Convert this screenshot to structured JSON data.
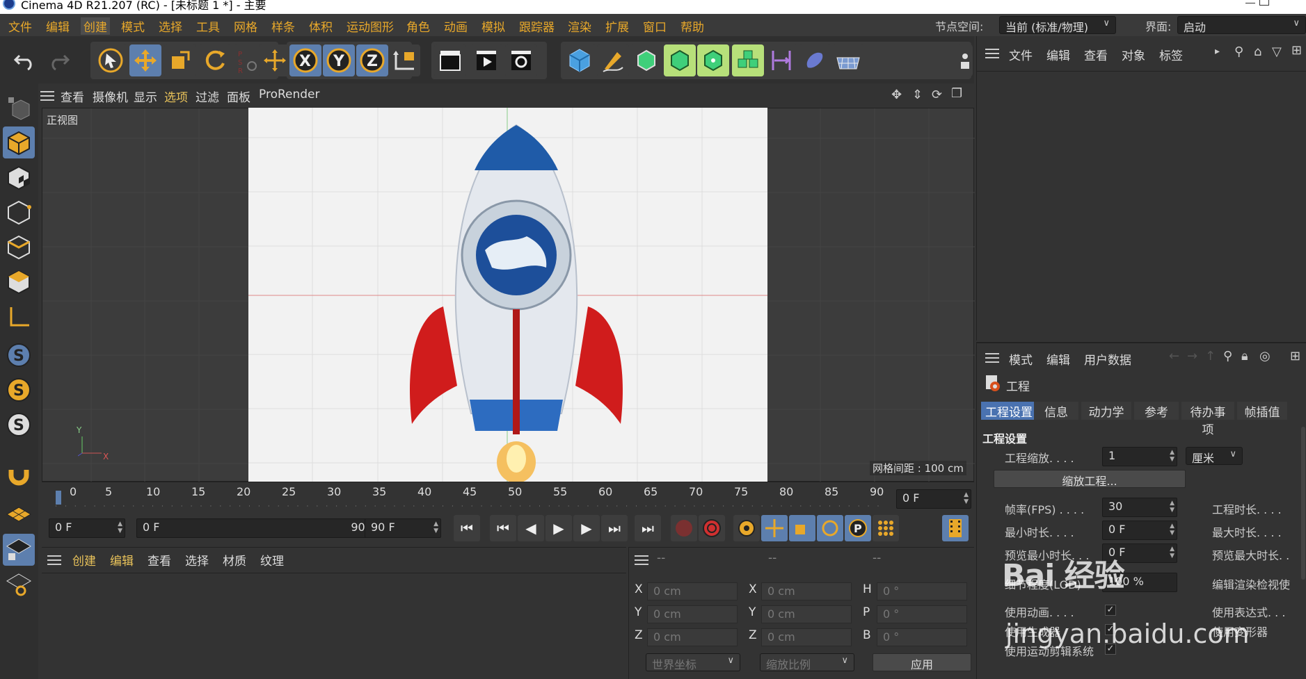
{
  "window": {
    "title": "Cinema 4D R21.207 (RC) - [未标题 1 *] - 主要"
  },
  "menubar": {
    "items": [
      "文件",
      "编辑",
      "创建",
      "模式",
      "选择",
      "工具",
      "网格",
      "样条",
      "体积",
      "运动图形",
      "角色",
      "动画",
      "模拟",
      "跟踪器",
      "渲染",
      "扩展",
      "窗口",
      "帮助"
    ],
    "node_space_label": "节点空间:",
    "node_space_value": "当前 (标准/物理)",
    "interface_label": "界面:",
    "interface_value": "启动"
  },
  "viewport_menu": {
    "items": [
      "查看",
      "摄像机",
      "显示",
      "选项",
      "过滤",
      "面板",
      "ProRender"
    ]
  },
  "viewport": {
    "label": "正视图",
    "grid_spacing": "网格间距 : 100 cm",
    "axis_y": "Y",
    "axis_x": "X"
  },
  "timeline": {
    "ticks": [
      "0",
      "5",
      "10",
      "15",
      "20",
      "25",
      "30",
      "35",
      "40",
      "45",
      "50",
      "55",
      "60",
      "65",
      "70",
      "75",
      "80",
      "85",
      "90"
    ],
    "current_frame": "0 F",
    "start_field": "0 F",
    "range_start": "0 F",
    "range_end": "90 F",
    "end_field": "90 F"
  },
  "material_panel": {
    "items": [
      "创建",
      "编辑",
      "查看",
      "选择",
      "材质",
      "纹理"
    ]
  },
  "coord_panel": {
    "header": [
      "--",
      "--",
      "--"
    ],
    "rows": [
      {
        "l1": "X",
        "v1": "0 cm",
        "l2": "X",
        "v2": "0 cm",
        "l3": "H",
        "v3": "0 °"
      },
      {
        "l1": "Y",
        "v1": "0 cm",
        "l2": "Y",
        "v2": "0 cm",
        "l3": "P",
        "v3": "0 °"
      },
      {
        "l1": "Z",
        "v1": "0 cm",
        "l2": "Z",
        "v2": "0 cm",
        "l3": "B",
        "v3": "0 °"
      }
    ],
    "world_coords": "世界坐标",
    "scale_ratio": "缩放比例",
    "apply": "应用"
  },
  "object_panel": {
    "items": [
      "文件",
      "编辑",
      "查看",
      "对象",
      "标签"
    ]
  },
  "attr_panel": {
    "items": [
      "模式",
      "编辑",
      "用户数据"
    ],
    "object_name": "工程",
    "tabs": [
      "工程设置",
      "信息",
      "动力学",
      "参考",
      "待办事项",
      "帧插值"
    ],
    "section": "工程设置",
    "project_scale_label": "工程缩放. . . .",
    "project_scale_value": "1",
    "project_scale_unit": "厘米",
    "scale_project_button": "缩放工程...",
    "fps_label": "帧率(FPS) . . . .",
    "fps_value": "30",
    "project_duration_label": "工程时长. . . .",
    "min_time_label": "最小时长. . . .",
    "min_time_value": "0 F",
    "max_time_label": "最大时长. . . .",
    "preview_min_label": "预览最小时长. . .",
    "preview_min_value": "0 F",
    "preview_max_label": "预览最大时长. .",
    "lod_label": "细节程度(LOD)",
    "lod_value": "100 %",
    "render_lod_label": "编辑渲染检视使",
    "use_animation_label": "使用动画. . . .",
    "use_expression_label": "使用表达式. . .",
    "use_generator_label": "使用生成器",
    "use_deformer_label": "使用变形器",
    "use_motion_clip_label": "使用运动剪辑系统"
  },
  "watermark": {
    "line1": "Bai 经验",
    "line2": "jingyan.baidu.com"
  },
  "colors": {
    "accent_orange": "#e8a82a",
    "highlight_blue": "#5d7fae",
    "tab_active": "#4a72b0"
  }
}
